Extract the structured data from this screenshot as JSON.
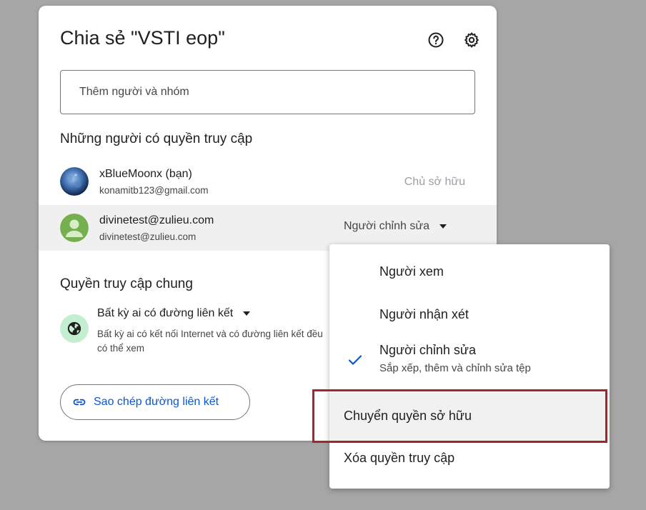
{
  "dialog": {
    "title": "Chia sẻ \"VSTI eop\"",
    "help_icon": "help-circle-icon",
    "settings_icon": "gear-icon",
    "add_placeholder": "Thêm người và nhóm",
    "access_section": "Những người có quyền truy cập",
    "people": [
      {
        "name": "xBlueMoonx (bạn)",
        "email": "konamitb123@gmail.com",
        "role": "Chủ sở hữu"
      },
      {
        "name": "divinetest@zulieu.com",
        "email": "divinetest@zulieu.com",
        "role": "Người chỉnh sửa"
      }
    ],
    "general_section": "Quyền truy cập chung",
    "general_option": "Bất kỳ ai có đường liên kết",
    "general_desc": "Bất kỳ ai có kết nối Internet và có đường liên kết đều có thể xem",
    "copy_link": "Sao chép đường liên kết"
  },
  "menu": {
    "items": [
      {
        "label": "Người xem"
      },
      {
        "label": "Người nhận xét"
      },
      {
        "label": "Người chỉnh sửa",
        "sub": "Sắp xếp, thêm và chỉnh sửa tệp",
        "checked": true
      },
      {
        "label": "Chuyển quyền sở hữu",
        "hovered": true
      },
      {
        "label": "Xóa quyền truy cập"
      }
    ]
  },
  "colors": {
    "accent": "#0b57d0",
    "highlight_frame": "#a4262c",
    "globe_bg": "#c4eed0"
  }
}
